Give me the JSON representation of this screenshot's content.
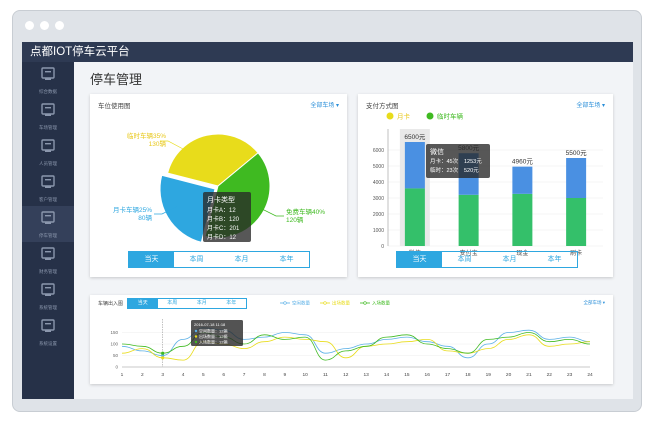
{
  "app": {
    "title": "点都IOT停车云平台"
  },
  "page": {
    "title": "停车管理"
  },
  "sidebar": {
    "items": [
      {
        "icon": "building-icon",
        "label": "综合数据"
      },
      {
        "icon": "grid-icon",
        "label": "车场管理"
      },
      {
        "icon": "monitor-icon",
        "label": "人员管理"
      },
      {
        "icon": "display-icon",
        "label": "客户管理"
      },
      {
        "icon": "car-icon",
        "label": "停车管理"
      },
      {
        "icon": "chart-icon",
        "label": "财务管理"
      },
      {
        "icon": "notebook-icon",
        "label": "系统管理"
      },
      {
        "icon": "screen-icon",
        "label": "系统设置"
      }
    ]
  },
  "colors": {
    "yellow": "#e8dc1b",
    "green": "#3fba21",
    "blue": "#2ea7e0",
    "barBlue": "#4a90e2",
    "barGreen": "#34c06a",
    "accent": "#2ea7e0"
  },
  "parking": {
    "title": "车位使用图",
    "link": "全部车场 ▾",
    "tabs": [
      "当天",
      "本周",
      "本月",
      "本年"
    ],
    "labels": {
      "temp": {
        "name": "临时车辆35%",
        "count": "130辆"
      },
      "month": {
        "name": "月卡车辆25%",
        "count": "80辆"
      },
      "free": {
        "name": "免费车辆40%",
        "count": "120辆"
      }
    },
    "tooltip": {
      "title": "月卡类型",
      "rows": [
        "月卡A：12",
        "月卡B：120",
        "月卡C：201",
        "月卡D：12"
      ]
    }
  },
  "payment": {
    "title": "支付方式图",
    "link": "全部车场 ▾",
    "tabs": [
      "当天",
      "本周",
      "本月",
      "本年"
    ],
    "legend": [
      "月卡",
      "临时车辆"
    ],
    "tooltip": {
      "title": "微信",
      "row1": "月卡：45次",
      "row1b": "1253元",
      "row2": "临时：23次",
      "row2b": "520元"
    }
  },
  "flow": {
    "title": "车辆出入图",
    "link": "全部车场 ▾",
    "tabs": [
      "当天",
      "本周",
      "本月",
      "本年"
    ],
    "legend": [
      "空闲数量",
      "出场数量",
      "入场数量"
    ],
    "tooltip": {
      "date": "2016-07-18   11:18",
      "rows": [
        "空闲数量：12辆",
        "出场数量：12辆",
        "入场数量：12辆"
      ]
    }
  },
  "chart_data": [
    {
      "type": "pie",
      "categories": [
        "临时车辆",
        "免费车辆",
        "月卡车辆"
      ],
      "values": [
        35,
        40,
        25
      ],
      "colors": [
        "#e8dc1b",
        "#3fba21",
        "#2ea7e0"
      ]
    },
    {
      "type": "bar",
      "categories": [
        "微信",
        "支付宝",
        "现金",
        "刷卡"
      ],
      "series": [
        {
          "name": "月卡",
          "values": [
            2900,
            2600,
            1700,
            2500
          ]
        },
        {
          "name": "临时车辆",
          "values": [
            3600,
            3200,
            3260,
            3000
          ]
        }
      ],
      "totals": [
        "6500元",
        "5800元",
        "4960元",
        "5500元"
      ],
      "ylim": [
        0,
        7000
      ],
      "yticks": [
        0,
        1000,
        2000,
        3000,
        4000,
        5000,
        6000
      ],
      "legend": "top-left"
    },
    {
      "type": "line",
      "x": [
        1,
        2,
        3,
        4,
        5,
        6,
        7,
        8,
        9,
        10,
        11,
        12,
        13,
        14,
        15,
        16,
        17,
        18,
        19,
        20,
        21,
        22,
        23,
        24
      ],
      "ylim": [
        0,
        200
      ],
      "yticks": [
        0,
        50,
        100,
        150
      ],
      "series": [
        {
          "name": "空闲数量",
          "values": [
            90,
            70,
            50,
            120,
            170,
            160,
            120,
            130,
            150,
            140,
            60,
            80,
            100,
            120,
            130,
            110,
            90,
            40,
            100,
            150,
            160,
            120,
            130,
            110
          ]
        },
        {
          "name": "出场数量",
          "values": [
            60,
            80,
            40,
            30,
            110,
            100,
            80,
            110,
            130,
            120,
            110,
            40,
            90,
            100,
            110,
            120,
            70,
            60,
            80,
            120,
            140,
            90,
            100,
            110
          ]
        },
        {
          "name": "入场数量",
          "values": [
            100,
            90,
            60,
            90,
            150,
            130,
            100,
            140,
            120,
            130,
            30,
            70,
            90,
            130,
            140,
            100,
            80,
            60,
            120,
            130,
            150,
            110,
            120,
            100
          ]
        }
      ],
      "colors": [
        "#5bb0e6",
        "#e8dc1b",
        "#3fba21"
      ]
    }
  ]
}
